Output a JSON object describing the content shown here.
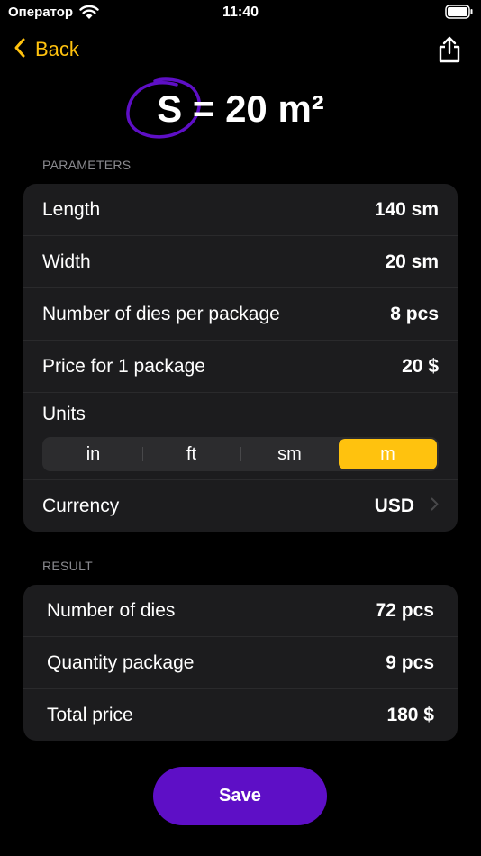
{
  "status_bar": {
    "carrier": "Оператор",
    "time": "11:40"
  },
  "nav": {
    "back_label": "Back"
  },
  "formula": "S = 20 m²",
  "parameters": {
    "section_label": "PARAMETERS",
    "rows": [
      {
        "label": "Length",
        "value": "140 sm"
      },
      {
        "label": "Width",
        "value": "20 sm"
      },
      {
        "label": "Number of dies per package",
        "value": "8 pcs"
      },
      {
        "label": "Price for 1 package",
        "value": "20 $"
      }
    ],
    "units": {
      "label": "Units",
      "options": [
        "in",
        "ft",
        "sm",
        "m"
      ],
      "selected": "m"
    },
    "currency": {
      "label": "Currency",
      "value": "USD"
    }
  },
  "result": {
    "section_label": "RESULT",
    "rows": [
      {
        "label": "Number of dies",
        "value": "72 pcs"
      },
      {
        "label": "Quantity package",
        "value": "9 pcs"
      },
      {
        "label": "Total price",
        "value": "180 $"
      }
    ]
  },
  "actions": {
    "save_label": "Save"
  },
  "colors": {
    "accent": "#FFC20E",
    "primary_button": "#5E0FC6",
    "circle_stroke": "#5E0FC6",
    "card": "#1c1c1e"
  }
}
